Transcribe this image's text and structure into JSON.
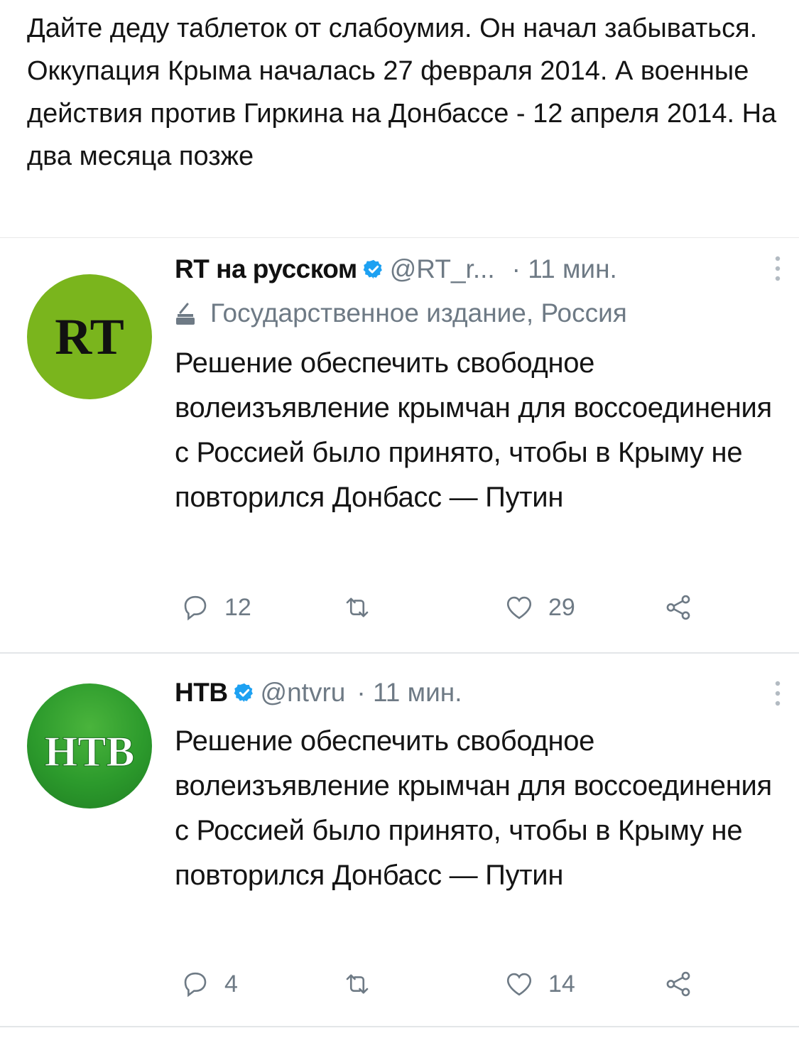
{
  "caption": {
    "line1": "Дайте деду таблеток от слабоумия. Он начал забываться.",
    "line2": "Оккупация Крыма началась 27 февраля 2014. А военные действия против Гиркина на Донбассе - 12 апреля 2014. На два месяца позже"
  },
  "tweets": [
    {
      "avatar_icon": "rt-logo",
      "avatar_text": "RT",
      "name": "RT на русском",
      "handle": "@RT_r...",
      "time": "· 11 мин.",
      "label": "Государственное издание, Россия",
      "text": "Решение обеспечить свободное волеизъявление крымчан для воссоединения с Россией было принято, чтобы в Крыму не повторился Донбасс — Путин",
      "replies": "12",
      "retweets": "",
      "likes": "29"
    },
    {
      "avatar_icon": "ntv-logo",
      "avatar_text": "НТВ",
      "name": "НТВ",
      "handle": "@ntvru",
      "time": "· 11 мин.",
      "text": "Решение обеспечить свободное волеизъявление крымчан для воссоединения с Россией было принято, чтобы в Крыму не повторился Донбасс — Путин",
      "replies": "4",
      "retweets": "",
      "likes": "14"
    }
  ],
  "colors": {
    "verified": "#1da1f2",
    "muted": "#6e7a85",
    "rt_green": "#7ab51d",
    "ntv_green": "#2c9a2c"
  }
}
